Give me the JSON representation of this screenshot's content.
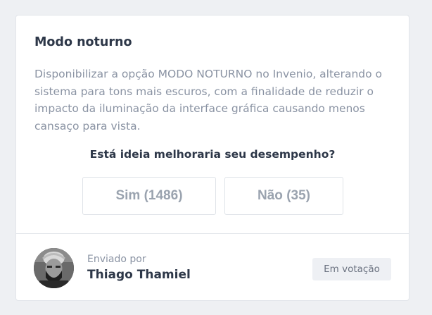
{
  "idea": {
    "title": "Modo noturno",
    "description": "Disponibilizar a opção MODO NOTURNO no Invenio, alterando o sistema para tons mais escuros, com a finalidade de reduzir o impacto da iluminação da interface gráfica causando menos cansaço para vista.",
    "question": "Está ideia melhoraria seu desempenho?",
    "vote_yes_label": "Sim (1486)",
    "vote_no_label": "Não (35)"
  },
  "author": {
    "sent_by_label": "Enviado por",
    "name": "Thiago Thamiel"
  },
  "status": {
    "label": "Em votação"
  },
  "colors": {
    "title_text": "#2d3748",
    "muted_text": "#8a93a3",
    "button_border": "#dfe3e8",
    "badge_bg": "#eef0f4",
    "page_bg": "#eef0f3"
  }
}
